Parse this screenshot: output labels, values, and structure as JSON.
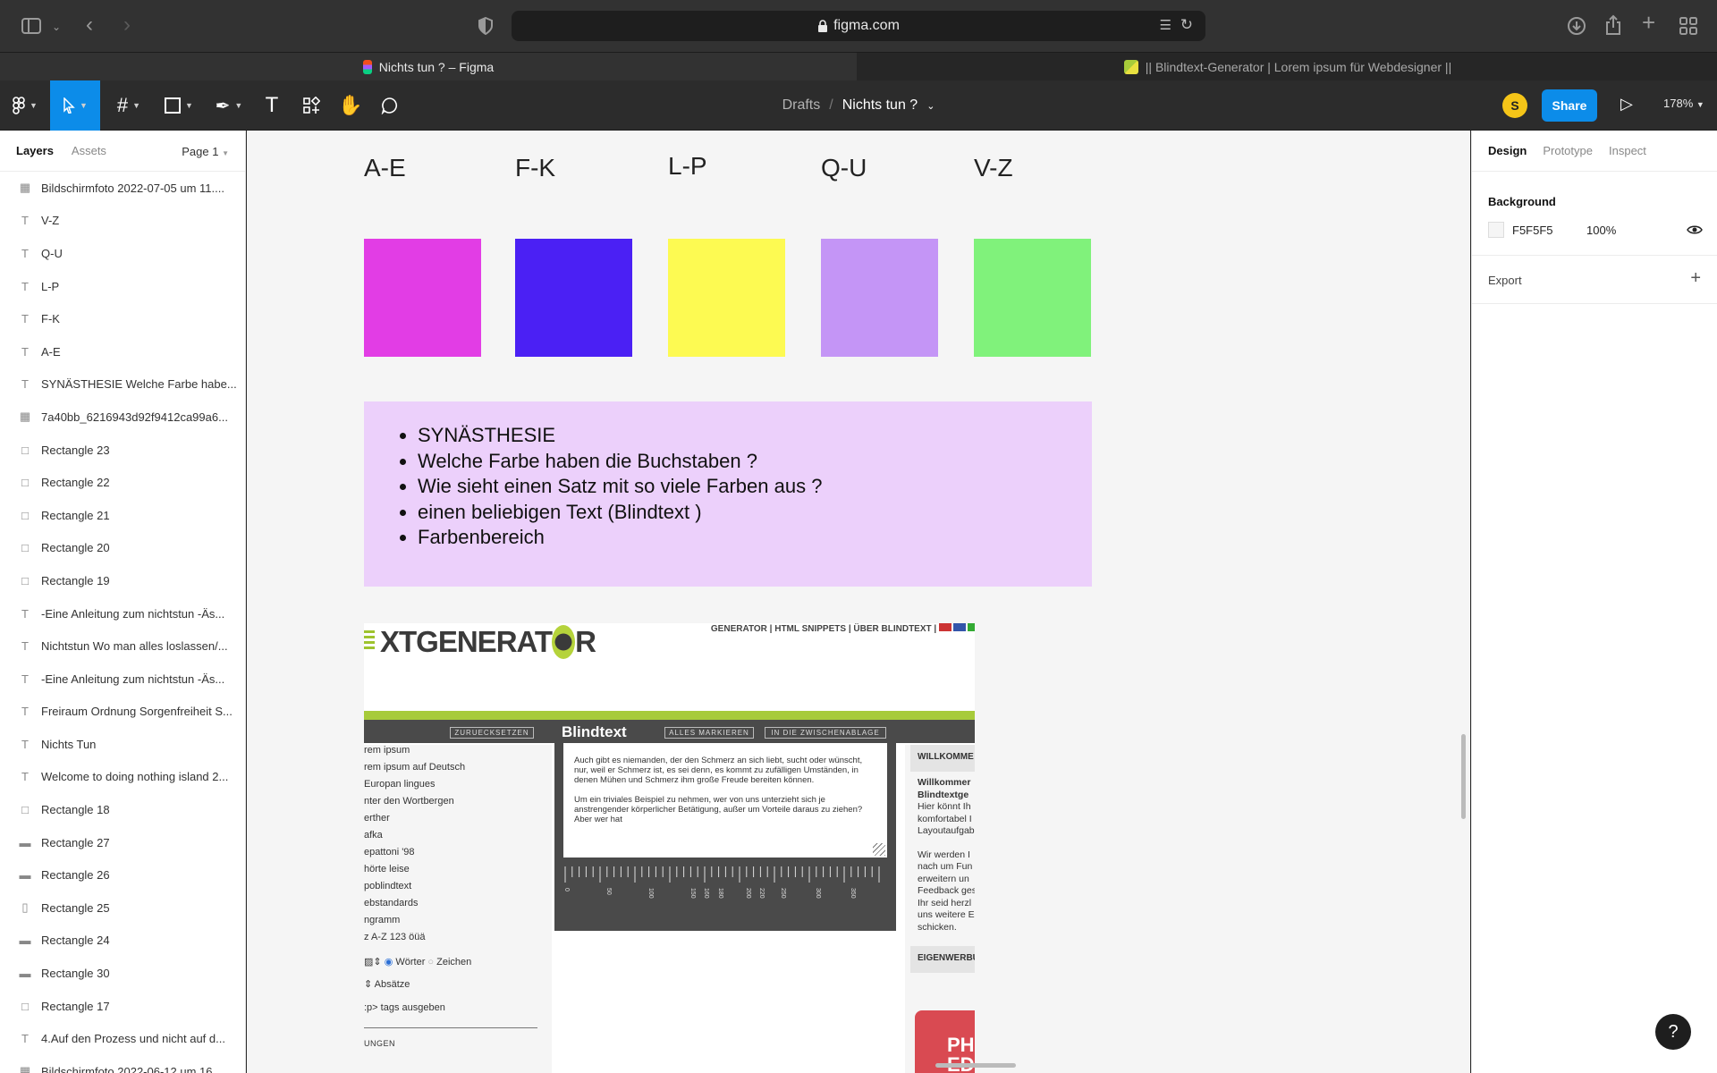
{
  "browser": {
    "url": "figma.com",
    "tabs": [
      {
        "title": "Nichts tun ? – Figma",
        "active": true
      },
      {
        "title": "|| Blindtext-Generator | Lorem ipsum für Webdesigner ||",
        "active": false
      }
    ]
  },
  "toolbar": {
    "breadcrumb_root": "Drafts",
    "breadcrumb_sep": "/",
    "file_name": "Nichts tun ?",
    "avatar_initial": "S",
    "share_label": "Share",
    "zoom": "178%"
  },
  "left_panel": {
    "tabs": [
      "Layers",
      "Assets"
    ],
    "page": "Page 1",
    "layers": [
      {
        "icon": "image",
        "name": "Bildschirmfoto 2022-07-05 um 11...."
      },
      {
        "icon": "text",
        "name": "V-Z"
      },
      {
        "icon": "text",
        "name": "Q-U"
      },
      {
        "icon": "text",
        "name": "L-P"
      },
      {
        "icon": "text",
        "name": "F-K"
      },
      {
        "icon": "text",
        "name": "A-E"
      },
      {
        "icon": "text",
        "name": "SYNÄSTHESIE Welche Farbe habe..."
      },
      {
        "icon": "image",
        "name": "7a40bb_6216943d92f9412ca99a6..."
      },
      {
        "icon": "rect",
        "name": "Rectangle 23"
      },
      {
        "icon": "rect",
        "name": "Rectangle 22"
      },
      {
        "icon": "rect",
        "name": "Rectangle 21"
      },
      {
        "icon": "rect",
        "name": "Rectangle 20"
      },
      {
        "icon": "rect",
        "name": "Rectangle 19"
      },
      {
        "icon": "text",
        "name": "-Eine Anleitung zum nichtstun -Äs..."
      },
      {
        "icon": "text",
        "name": "Nichtstun Wo man alles loslassen/..."
      },
      {
        "icon": "text",
        "name": "-Eine Anleitung zum nichtstun -Äs..."
      },
      {
        "icon": "text",
        "name": "Freiraum Ordnung Sorgenfreiheit S..."
      },
      {
        "icon": "text",
        "name": "Nichts Tun"
      },
      {
        "icon": "text",
        "name": "Welcome to doing nothing island 2..."
      },
      {
        "icon": "rect",
        "name": "Rectangle 18"
      },
      {
        "icon": "rect-wide",
        "name": "Rectangle 27"
      },
      {
        "icon": "rect-wide",
        "name": "Rectangle 26"
      },
      {
        "icon": "rect-tall",
        "name": "Rectangle 25"
      },
      {
        "icon": "rect-wide",
        "name": "Rectangle 24"
      },
      {
        "icon": "rect-wide",
        "name": "Rectangle 30"
      },
      {
        "icon": "rect",
        "name": "Rectangle 17"
      },
      {
        "icon": "text",
        "name": "4.Auf den Prozess und nicht auf d..."
      },
      {
        "icon": "image",
        "name": "Bildschirmfoto 2022-06-12 um 16..."
      }
    ]
  },
  "canvas": {
    "swatches": [
      {
        "label": "A-E",
        "color": "#e23de5"
      },
      {
        "label": "F-K",
        "color": "#4b20f4"
      },
      {
        "label": "L-P",
        "color": "#fdfa52"
      },
      {
        "label": "Q-U",
        "color": "#c495f6"
      },
      {
        "label": "V-Z",
        "color": "#80f27b"
      }
    ],
    "bullet_box_color": "#ecd0fb",
    "bullets": [
      "SYNÄSTHESIE",
      "Welche Farbe haben die Buchstaben ?",
      "Wie sieht einen Satz mit so viele Farben aus ?",
      "einen beliebigen Text (Blindtext )",
      "Farbenbereich"
    ],
    "embed": {
      "logo": "XTGENERAT",
      "logo_o": "O",
      "logo_end": "R",
      "nav": "GENERATOR  |  HTML SNIPPETS  |  ÜBER BLINDTEXT  |",
      "btn_reset": "ZURUECKSETZEN",
      "title": "Blindtext",
      "btn_mark": "ALLES MARKIEREN",
      "btn_clip": "IN DIE ZWISCHENABLAGE",
      "sidebar_items": [
        "rem ipsum",
        "rem ipsum auf Deutsch",
        "Europan lingues",
        "nter den Wortbergen",
        "erther",
        "afka",
        "epattoni '98",
        "hörte leise",
        "poblindtext",
        "ebstandards",
        "ngramm",
        "z A-Z 123 öüä"
      ],
      "radio_words": "Wörter",
      "radio_chars": "Zeichen",
      "paragraphs_label": "Absätze",
      "tags_label": ":p> tags ausgeben",
      "settings_label": "UNGEN",
      "text_p1": "Auch gibt es niemanden, der den Schmerz an sich liebt, sucht oder wünscht, nur, weil er Schmerz ist, es sei denn, es kommt zu zufälligen Umständen, in denen Mühen und Schmerz ihm große Freude bereiten können.",
      "text_p2": "Um ein triviales Beispiel zu nehmen, wer von uns unterzieht sich je anstrengender körperlicher Betätigung, außer um Vorteile daraus zu ziehen? Aber wer hat",
      "ruler_labels": [
        "0",
        "50",
        "100",
        "150",
        "160",
        "180",
        "200",
        "220",
        "250",
        "300",
        "350"
      ],
      "right_head": "WILLKOMME",
      "right_lines": [
        "Willkommer",
        "Blindtextge",
        "Hier könnt Ih",
        "komfortabel I",
        "Layoutaufgab",
        "",
        "Wir werden I",
        "nach um Fun",
        "erweitern un",
        "Feedback ges",
        "Ihr seid herzl",
        "uns weitere E",
        "schicken."
      ],
      "right_head2": "EIGENWERBU",
      "promo": "PH ED"
    }
  },
  "right_panel": {
    "tabs": [
      "Design",
      "Prototype",
      "Inspect"
    ],
    "background_label": "Background",
    "bg_hex": "F5F5F5",
    "bg_opacity": "100%",
    "export_label": "Export"
  }
}
